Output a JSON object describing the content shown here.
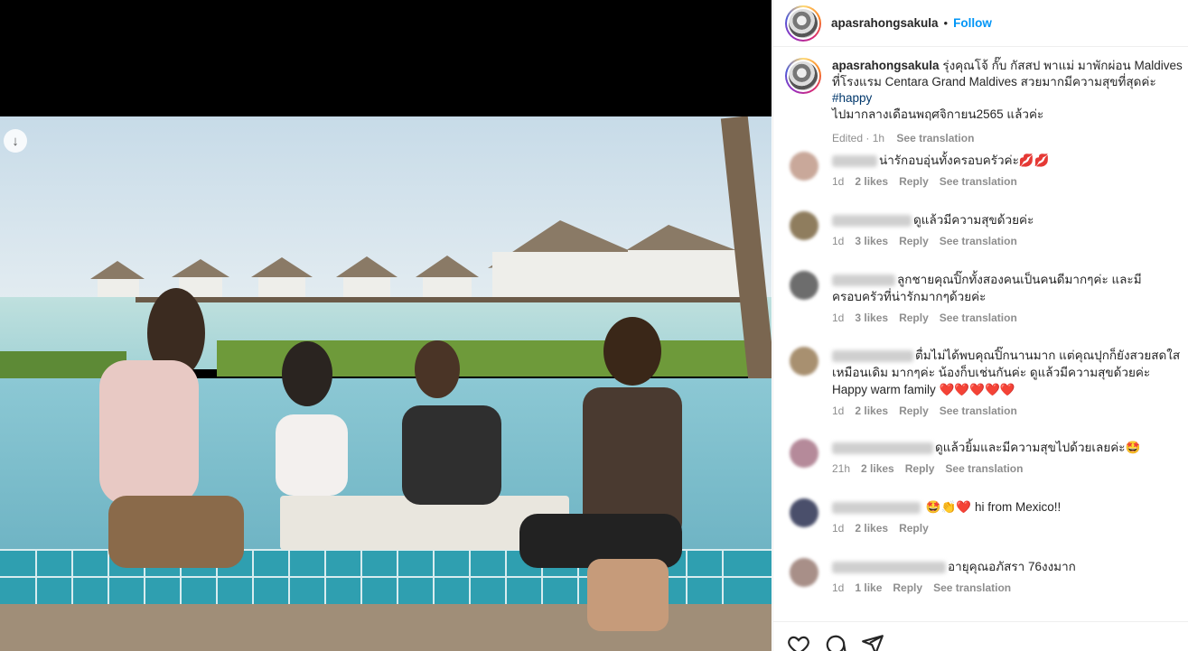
{
  "post": {
    "username": "apasrahongsakula",
    "separator": "•",
    "follow_label": "Follow",
    "caption_text": "รุ่งคุณโจ้ กั๊บ กัสสป พาแม่ มาพักผ่อน Maldives ที่โรงแรม Centara Grand Maldives สวยมากมีความสุขที่สุดค่ะ",
    "caption_hashtag": "#happy",
    "caption_tail": "ไปมากลางเดือนพฤศจิกายน2565 แล้วค่ะ",
    "edited_label": "Edited · 1h",
    "see_translation": "See translation"
  },
  "comments": [
    {
      "text": "น่ารักอบอุ่นทั้งครอบครัวค่ะ",
      "emoji": "💋💋",
      "age": "1d",
      "likes": "2 likes",
      "reply": "Reply",
      "translate": "See translation",
      "avatar_color": "#c9a89a"
    },
    {
      "text": "ดูแล้วมีความสุขด้วยค่ะ",
      "emoji": "",
      "age": "1d",
      "likes": "3 likes",
      "reply": "Reply",
      "translate": "See translation",
      "avatar_color": "#8f7d5e"
    },
    {
      "text": "ลูกชายคุณปิ๊กทั้งสองคนเป็นคนดีมากๆค่ะ และมีครอบครัวที่น่ารักมากๆด้วยค่ะ",
      "emoji": "",
      "age": "1d",
      "likes": "3 likes",
      "reply": "Reply",
      "translate": "See translation",
      "avatar_color": "#6d6d6d"
    },
    {
      "text": "ตื่มไม่ได้พบคุณปิ๊กนานมาก แต่คุณปุกก็ยังสวยสดใสเหมือนเดิม มากๆค่ะ น้องก็บเช่นกันค่ะ ดูแล้วมีความสุขด้วยค่ะ Happy warm family",
      "emoji": "❤️❤️❤️❤️❤️",
      "age": "1d",
      "likes": "2 likes",
      "reply": "Reply",
      "translate": "See translation",
      "avatar_color": "#a89070"
    },
    {
      "text": "ดูแล้วยิ้มและมีความสุขไปด้วยเลยค่ะ",
      "emoji": "🤩",
      "age": "21h",
      "likes": "2 likes",
      "reply": "Reply",
      "translate": "See translation",
      "avatar_color": "#b58a9a"
    },
    {
      "text": "hi from Mexico!!",
      "emoji": "🤩👏❤️",
      "age": "1d",
      "likes": "2 likes",
      "reply": "Reply",
      "translate": "",
      "avatar_color": "#4a4f6b"
    },
    {
      "text": "อายุคุณอภัสรา 76งงมาก",
      "emoji": "",
      "age": "1d",
      "likes": "1 like",
      "reply": "Reply",
      "translate": "See translation",
      "avatar_color": "#a88f88"
    }
  ],
  "icons": {
    "like": "heart-icon",
    "comment": "comment-icon",
    "share": "share-icon",
    "download": "download-icon"
  },
  "colors": {
    "follow": "#0095f6",
    "hashtag": "#00376b",
    "meta": "#8e8e8e"
  }
}
